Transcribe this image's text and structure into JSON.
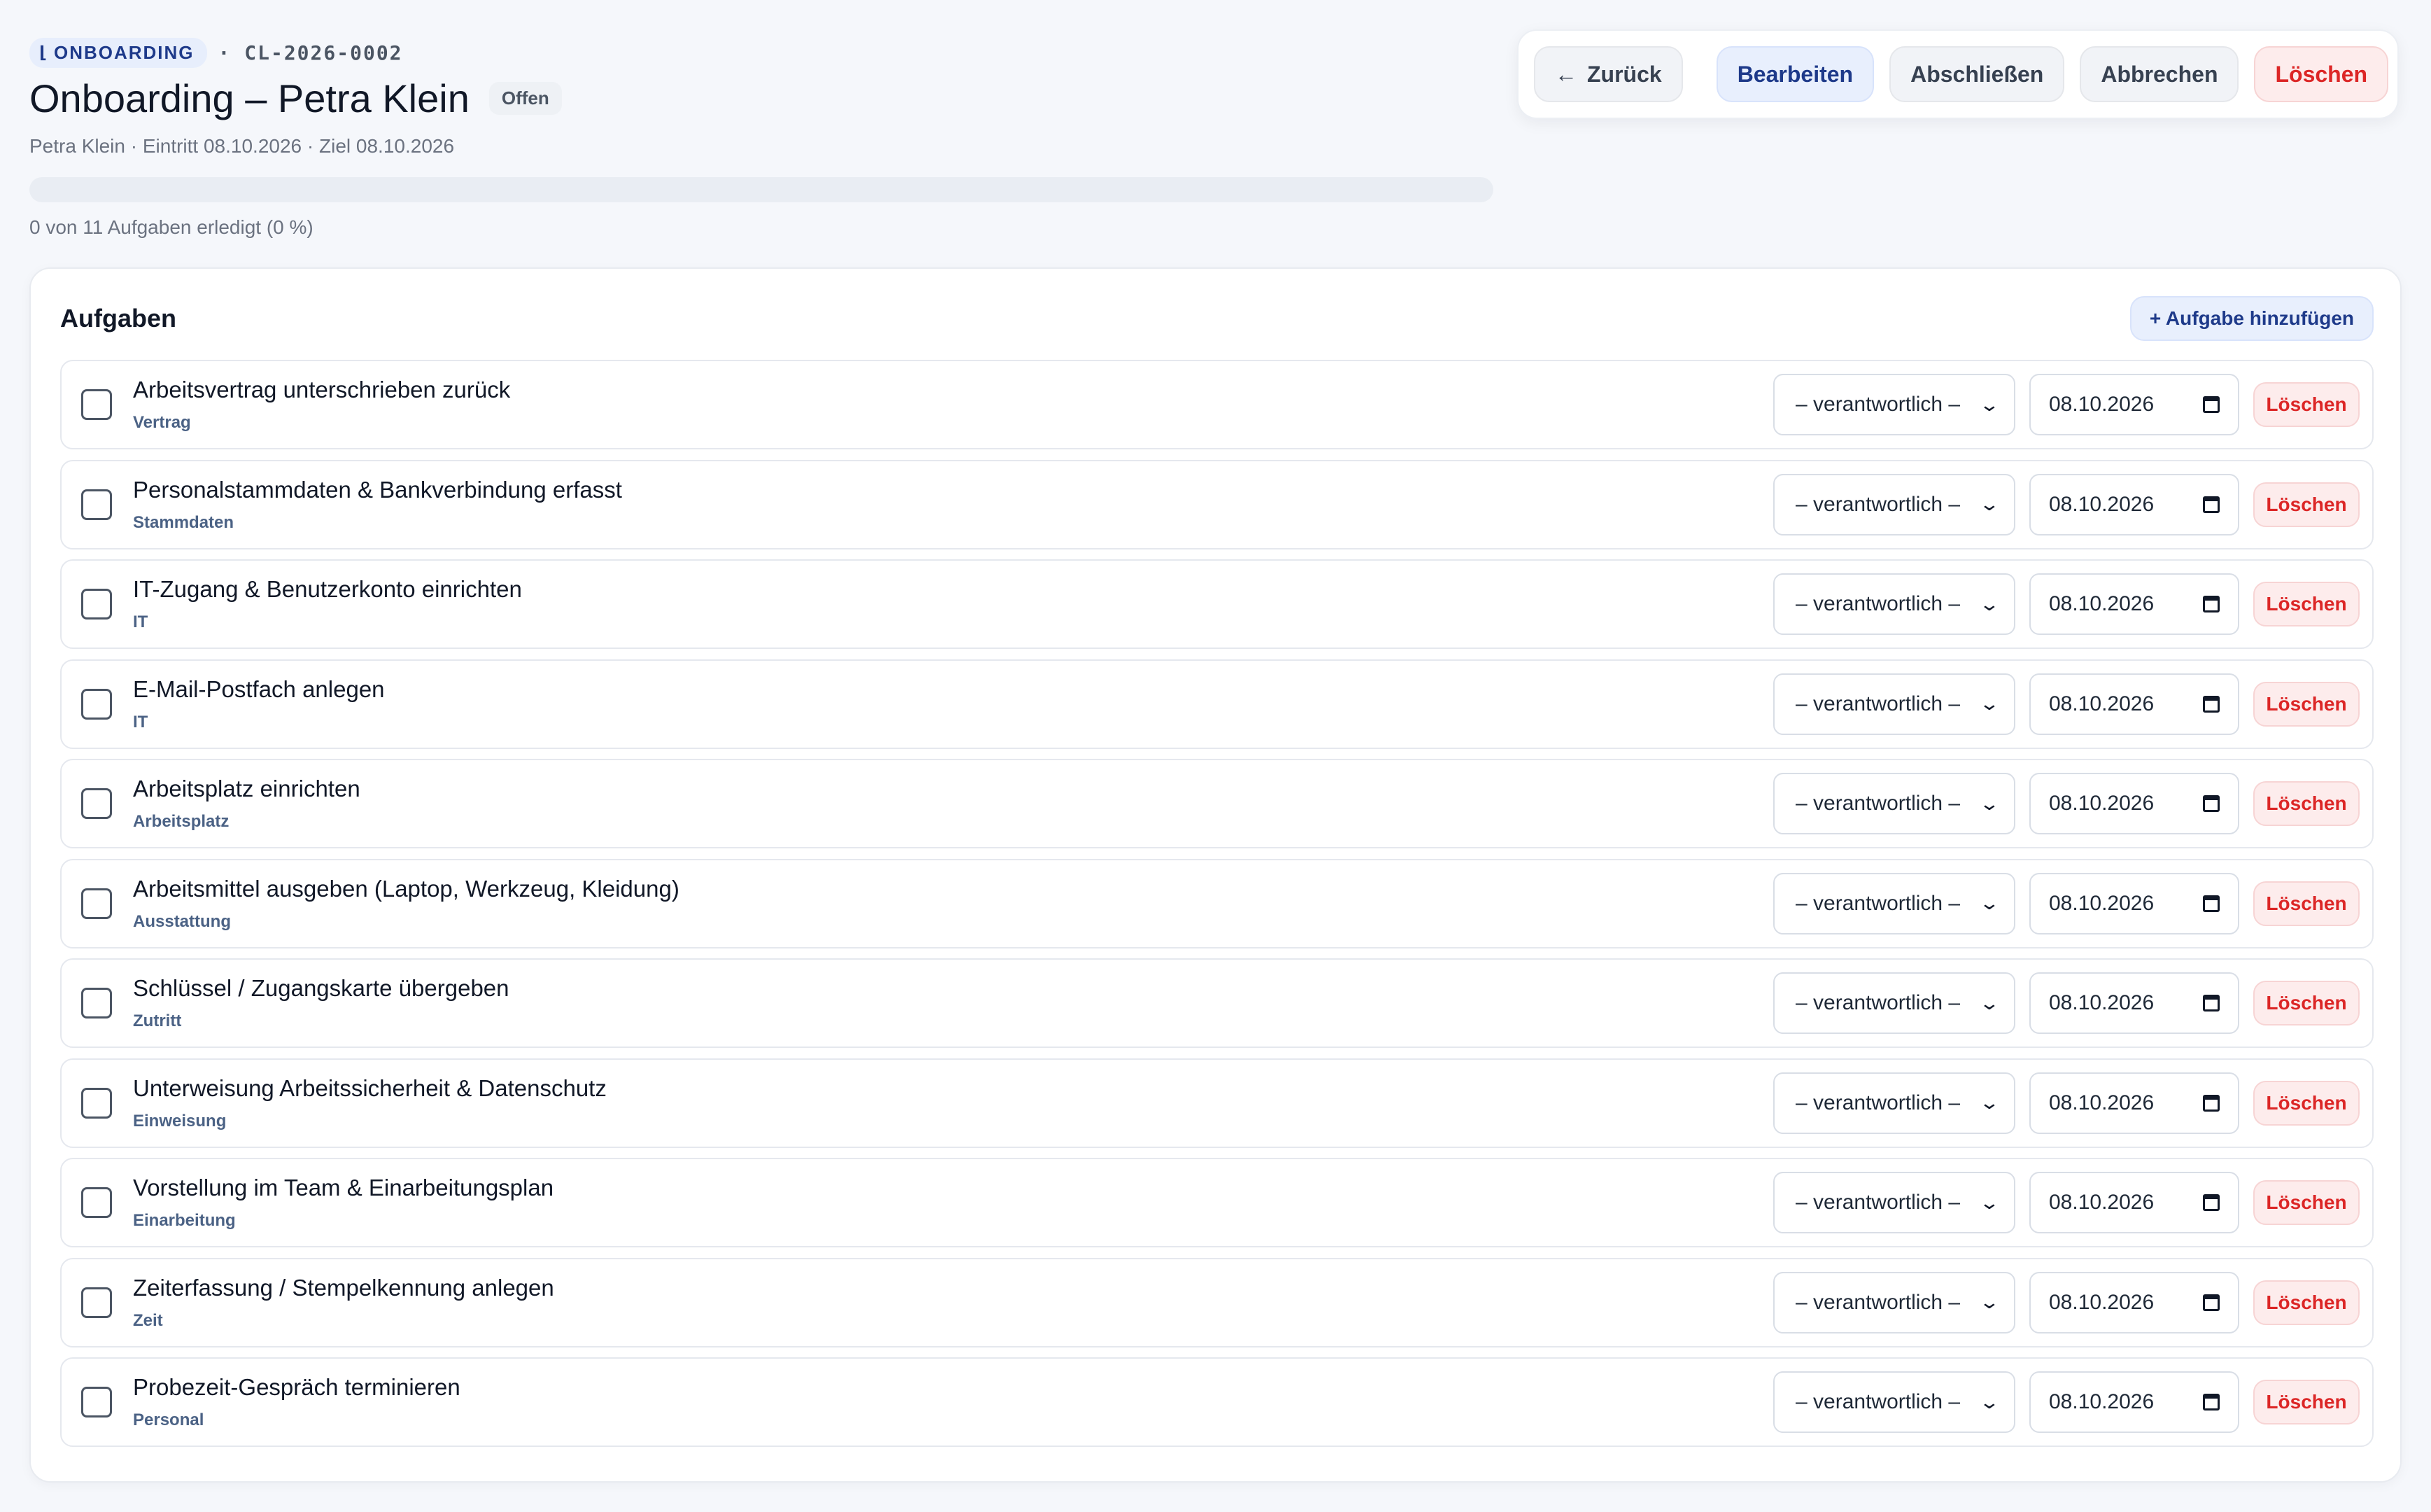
{
  "header": {
    "type_badge": "ONBOARDING",
    "case_id": "· CL-2026-0002",
    "title": "Onboarding – Petra Klein",
    "status": "Offen",
    "subtitle": "Petra Klein · Eintritt 08.10.2026 · Ziel 08.10.2026",
    "progress_percent": 0,
    "progress_text": "0 von 11 Aufgaben erledigt (0 %)"
  },
  "actions": {
    "back": "Zurück",
    "edit": "Bearbeiten",
    "complete": "Abschließen",
    "cancel": "Abbrechen",
    "delete": "Löschen"
  },
  "tasks_card": {
    "title": "Aufgaben",
    "add_button": "+ Aufgabe hinzufügen",
    "assignee_placeholder": "– verantwortlich –",
    "delete_label": "Löschen",
    "items": [
      {
        "title": "Arbeitsvertrag unterschrieben zurück",
        "category": "Vertrag",
        "date": "08.10.2026",
        "done": false
      },
      {
        "title": "Personalstammdaten & Bankverbindung erfasst",
        "category": "Stammdaten",
        "date": "08.10.2026",
        "done": false
      },
      {
        "title": "IT-Zugang & Benutzerkonto einrichten",
        "category": "IT",
        "date": "08.10.2026",
        "done": false
      },
      {
        "title": "E-Mail-Postfach anlegen",
        "category": "IT",
        "date": "08.10.2026",
        "done": false
      },
      {
        "title": "Arbeitsplatz einrichten",
        "category": "Arbeitsplatz",
        "date": "08.10.2026",
        "done": false
      },
      {
        "title": "Arbeitsmittel ausgeben (Laptop, Werkzeug, Kleidung)",
        "category": "Ausstattung",
        "date": "08.10.2026",
        "done": false
      },
      {
        "title": "Schlüssel / Zugangskarte übergeben",
        "category": "Zutritt",
        "date": "08.10.2026",
        "done": false
      },
      {
        "title": "Unterweisung Arbeitssicherheit & Datenschutz",
        "category": "Einweisung",
        "date": "08.10.2026",
        "done": false
      },
      {
        "title": "Vorstellung im Team & Einarbeitungsplan",
        "category": "Einarbeitung",
        "date": "08.10.2026",
        "done": false
      },
      {
        "title": "Zeiterfassung / Stempelkennung anlegen",
        "category": "Zeit",
        "date": "08.10.2026",
        "done": false
      },
      {
        "title": "Probezeit-Gespräch terminieren",
        "category": "Personal",
        "date": "08.10.2026",
        "done": false
      }
    ]
  },
  "colors": {
    "accent": "#1e3a8a",
    "danger": "#dc2626",
    "background": "#f5f7fb"
  },
  "icons": {
    "type_badge": "tag-icon",
    "back": "arrow-left-icon",
    "date": "calendar-icon",
    "select": "chevron-down-icon"
  }
}
